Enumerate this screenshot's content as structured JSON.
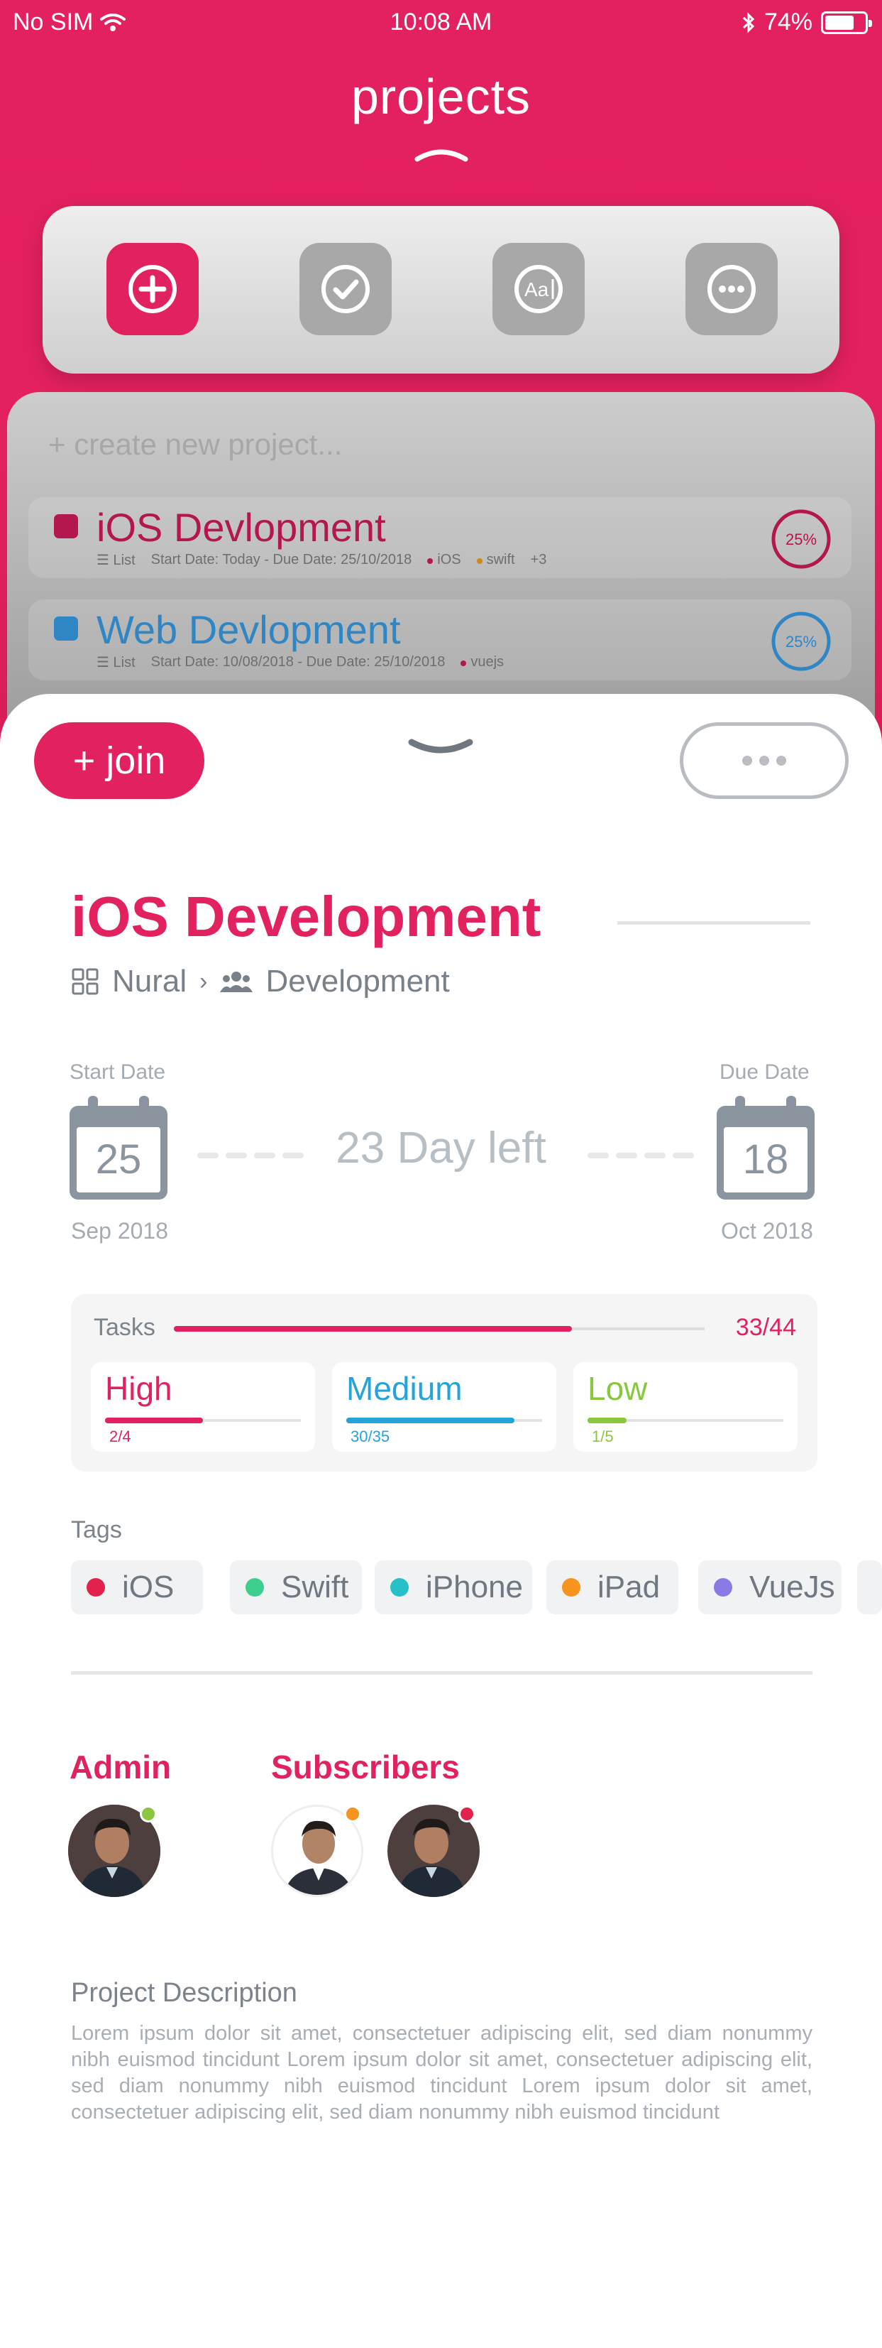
{
  "status_bar": {
    "carrier": "No SIM",
    "time": "10:08 AM",
    "battery": "74%",
    "battery_level": 0.74
  },
  "header": {
    "title": "projects"
  },
  "toolbar": {
    "icons": [
      "plus-icon",
      "check-icon",
      "text-icon",
      "more-icon"
    ]
  },
  "list": {
    "placeholder": "+ create new project...",
    "projects": [
      {
        "name": "iOS Devlopment",
        "view": "List",
        "dates": "Start Date: Today - Due Date: 25/10/2018",
        "tags": [
          "iOS",
          "swift"
        ],
        "more_tags": "+3",
        "progress": "25%",
        "progress_value": 0.25,
        "color": "#b4174f"
      },
      {
        "name": "Web Devlopment",
        "view": "List",
        "dates": "Start Date:  10/08/2018 - Due Date: 25/10/2018",
        "tags": [
          "vuejs"
        ],
        "more_tags": "",
        "progress": "25%",
        "progress_value": 0.25,
        "color": "#2f86c4"
      }
    ]
  },
  "detail": {
    "join_label": "+ join",
    "title": "iOS Development",
    "owner": "Nural",
    "team": "Development",
    "start_label": "Start Date",
    "due_label": "Due Date",
    "start_day": "25",
    "due_day": "18",
    "start_month": "Sep 2018",
    "due_month": "Oct 2018",
    "days_left": "23 Day left",
    "tasks": {
      "label": "Tasks",
      "count": "33/44",
      "progress": 0.75,
      "priorities": [
        {
          "label": "High",
          "value": "2/4",
          "progress": 0.5,
          "color": "#e2225f"
        },
        {
          "label": "Medium",
          "value": "30/35",
          "progress": 0.86,
          "color": "#26a3d9"
        },
        {
          "label": "Low",
          "value": "1/5",
          "progress": 0.2,
          "color": "#8cc63f"
        }
      ]
    },
    "tags_label": "Tags",
    "tags": [
      {
        "label": "iOS",
        "color": "#e2224d"
      },
      {
        "label": "Swift",
        "color": "#3ccf8e"
      },
      {
        "label": "iPhone",
        "color": "#26c0c8"
      },
      {
        "label": "iPad",
        "color": "#f7941d"
      },
      {
        "label": "VueJs",
        "color": "#8a7ae6"
      },
      {
        "label": "",
        "color": "#8cc63f"
      }
    ],
    "admin_label": "Admin",
    "subscribers_label": "Subscribers",
    "description_title": "Project Description",
    "description": "Lorem ipsum dolor sit amet, consectetuer adipiscing elit, sed diam nonummy nibh euismod tincidunt  Lorem ipsum dolor sit amet, consectetuer adipiscing elit, sed diam nonummy nibh euismod tincidunt Lorem ipsum dolor sit amet, consectetuer adipiscing elit, sed diam nonummy nibh euismod tincidunt"
  }
}
